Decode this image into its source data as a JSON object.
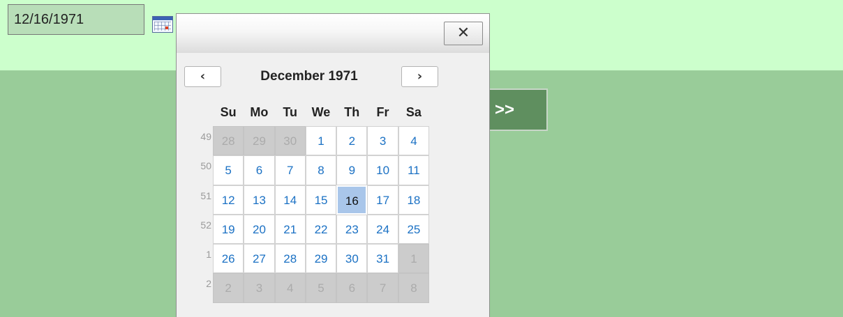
{
  "date_field": {
    "value": "12/16/1971"
  },
  "calendar_button": {
    "icon": "calendar-icon"
  },
  "next_step_button": {
    "label": ">>"
  },
  "popup": {
    "close_label": "✕",
    "prev_label": "‹",
    "next_label": "›",
    "month_title": "December 1971",
    "weekdays": [
      "Su",
      "Mo",
      "Tu",
      "We",
      "Th",
      "Fr",
      "Sa"
    ],
    "weeks": [
      {
        "number": "49",
        "days": [
          {
            "d": "28",
            "m": "prev"
          },
          {
            "d": "29",
            "m": "prev"
          },
          {
            "d": "30",
            "m": "prev"
          },
          {
            "d": "1",
            "m": "cur"
          },
          {
            "d": "2",
            "m": "cur"
          },
          {
            "d": "3",
            "m": "cur"
          },
          {
            "d": "4",
            "m": "cur"
          }
        ]
      },
      {
        "number": "50",
        "days": [
          {
            "d": "5",
            "m": "cur"
          },
          {
            "d": "6",
            "m": "cur"
          },
          {
            "d": "7",
            "m": "cur"
          },
          {
            "d": "8",
            "m": "cur"
          },
          {
            "d": "9",
            "m": "cur"
          },
          {
            "d": "10",
            "m": "cur"
          },
          {
            "d": "11",
            "m": "cur"
          }
        ]
      },
      {
        "number": "51",
        "days": [
          {
            "d": "12",
            "m": "cur"
          },
          {
            "d": "13",
            "m": "cur"
          },
          {
            "d": "14",
            "m": "cur"
          },
          {
            "d": "15",
            "m": "cur"
          },
          {
            "d": "16",
            "m": "cur",
            "selected": true
          },
          {
            "d": "17",
            "m": "cur"
          },
          {
            "d": "18",
            "m": "cur"
          }
        ]
      },
      {
        "number": "52",
        "days": [
          {
            "d": "19",
            "m": "cur"
          },
          {
            "d": "20",
            "m": "cur"
          },
          {
            "d": "21",
            "m": "cur"
          },
          {
            "d": "22",
            "m": "cur"
          },
          {
            "d": "23",
            "m": "cur"
          },
          {
            "d": "24",
            "m": "cur"
          },
          {
            "d": "25",
            "m": "cur"
          }
        ]
      },
      {
        "number": "1",
        "days": [
          {
            "d": "26",
            "m": "cur"
          },
          {
            "d": "27",
            "m": "cur"
          },
          {
            "d": "28",
            "m": "cur"
          },
          {
            "d": "29",
            "m": "cur"
          },
          {
            "d": "30",
            "m": "cur"
          },
          {
            "d": "31",
            "m": "cur"
          },
          {
            "d": "1",
            "m": "next"
          }
        ]
      },
      {
        "number": "2",
        "days": [
          {
            "d": "2",
            "m": "next"
          },
          {
            "d": "3",
            "m": "next"
          },
          {
            "d": "4",
            "m": "next"
          },
          {
            "d": "5",
            "m": "next"
          },
          {
            "d": "6",
            "m": "next"
          },
          {
            "d": "7",
            "m": "next"
          },
          {
            "d": "8",
            "m": "next"
          }
        ]
      }
    ]
  },
  "colors": {
    "page_background": "#99cc99",
    "top_band": "#ccffcc",
    "current_day_text": "#1b71c4",
    "selected_day_background": "#a9c6ea",
    "other_month_background": "#cccccc",
    "next_button_background": "#5f8f5f"
  }
}
